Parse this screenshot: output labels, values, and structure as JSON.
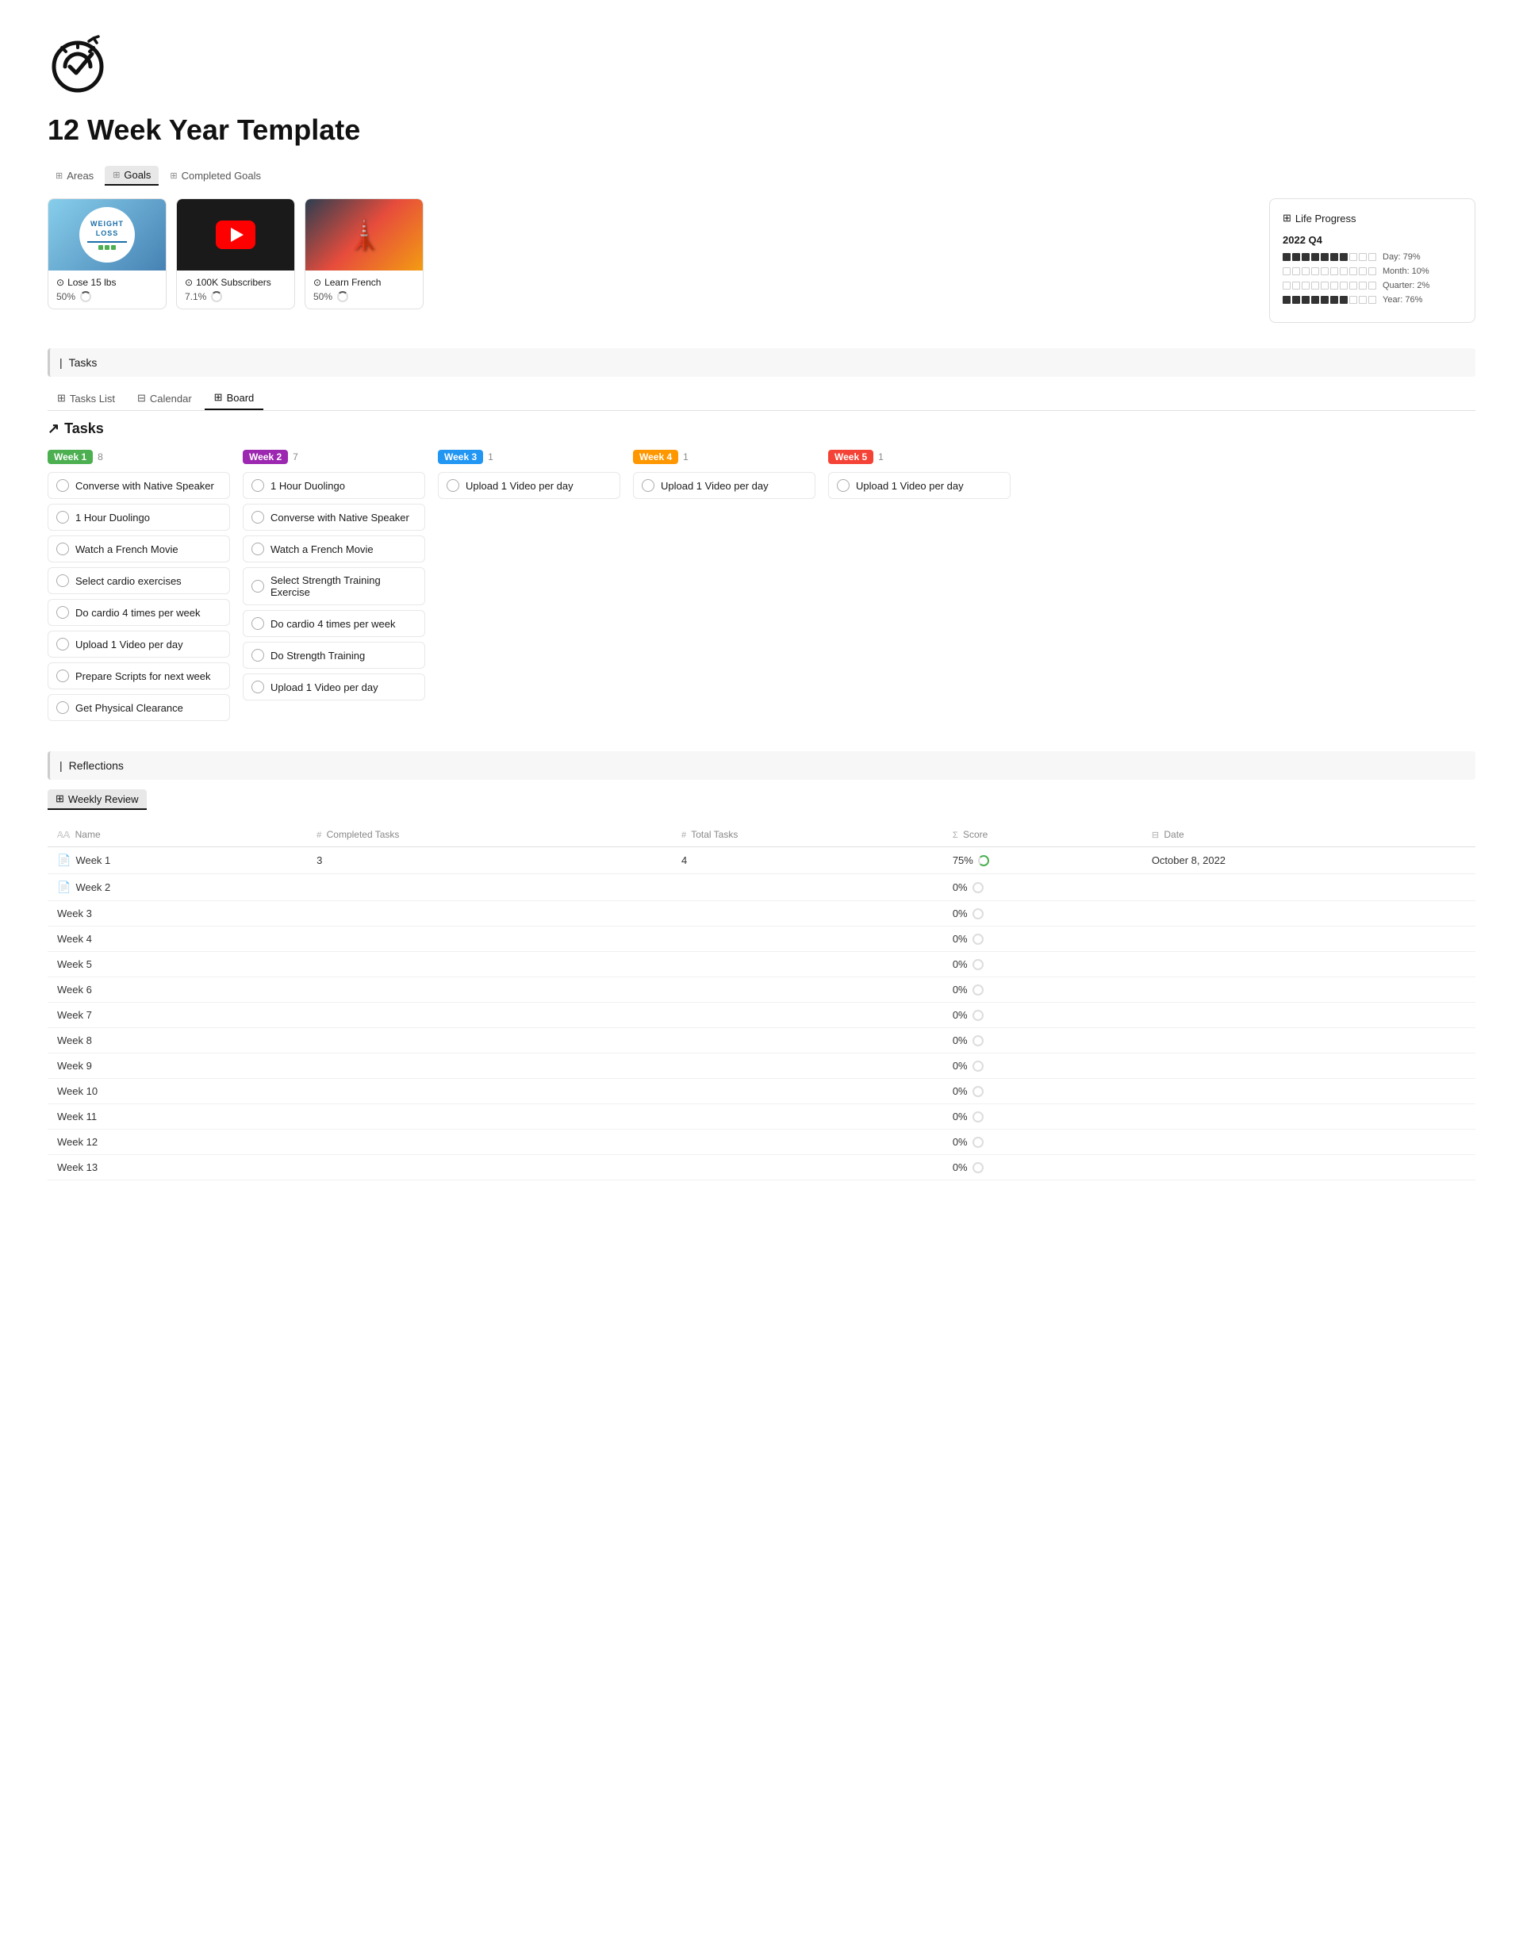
{
  "app": {
    "title": "12 Week Year Template"
  },
  "top_tabs": [
    {
      "id": "areas",
      "label": "Areas",
      "icon": "⊞",
      "active": false
    },
    {
      "id": "goals",
      "label": "Goals",
      "icon": "⊞",
      "active": true
    },
    {
      "id": "completed_goals",
      "label": "Completed Goals",
      "icon": "⊞",
      "active": false
    }
  ],
  "goals": [
    {
      "id": "lose-15-lbs",
      "title": "Lose 15 lbs",
      "progress": "50%",
      "image_type": "weight",
      "goal_icon": "⊙"
    },
    {
      "id": "100k-subscribers",
      "title": "100K Subscribers",
      "progress": "7.1%",
      "image_type": "youtube",
      "goal_icon": "⊙"
    },
    {
      "id": "learn-french",
      "title": "Learn French",
      "progress": "50%",
      "image_type": "french",
      "goal_icon": "⊙"
    }
  ],
  "life_progress": {
    "title": "Life Progress",
    "year_label": "2022 Q4",
    "rows": [
      {
        "filled": 7,
        "total": 10,
        "label": "Day: 79%"
      },
      {
        "filled": 1,
        "total": 10,
        "label": "Month: 10%"
      },
      {
        "filled": 0,
        "total": 10,
        "label": "Quarter: 2%"
      },
      {
        "filled": 7,
        "total": 10,
        "label": "Year: 76%"
      }
    ]
  },
  "tasks_section": {
    "section_label": "Tasks",
    "tabs": [
      {
        "id": "tasks-list",
        "label": "Tasks List",
        "icon": "⊞",
        "active": false
      },
      {
        "id": "calendar",
        "label": "Calendar",
        "icon": "⊟",
        "active": false
      },
      {
        "id": "board",
        "label": "Board",
        "icon": "⊞",
        "active": true
      }
    ],
    "heading": "Tasks",
    "columns": [
      {
        "id": "week1",
        "label": "Week 1",
        "badge_class": "badge-week1",
        "count": 8,
        "tasks": [
          "Converse with Native Speaker",
          "1 Hour Duolingo",
          "Watch a French Movie",
          "Select cardio exercises",
          "Do cardio 4 times per week",
          "Upload 1 Video per day",
          "Prepare Scripts for next week",
          "Get Physical Clearance"
        ]
      },
      {
        "id": "week2",
        "label": "Week 2",
        "badge_class": "badge-week2",
        "count": 7,
        "tasks": [
          "1 Hour Duolingo",
          "Converse with Native Speaker",
          "Watch a French Movie",
          "Select Strength Training Exercise",
          "Do cardio 4 times per week",
          "Do Strength Training",
          "Upload 1 Video per day"
        ]
      },
      {
        "id": "week3",
        "label": "Week 3",
        "badge_class": "badge-week3",
        "count": 1,
        "tasks": [
          "Upload 1 Video per day"
        ]
      },
      {
        "id": "week4",
        "label": "Week 4",
        "badge_class": "badge-week4",
        "count": 1,
        "tasks": [
          "Upload 1 Video per day"
        ]
      },
      {
        "id": "week5",
        "label": "Week 5",
        "badge_class": "badge-week5",
        "count": 1,
        "tasks": [
          "Upload 1 Video per day"
        ]
      }
    ]
  },
  "reflections_section": {
    "section_label": "Reflections",
    "sub_tab": "Weekly Review",
    "table": {
      "columns": [
        {
          "id": "name",
          "icon": "𝔸𝔸",
          "label": "Name"
        },
        {
          "id": "completed_tasks",
          "icon": "#",
          "label": "Completed Tasks"
        },
        {
          "id": "total_tasks",
          "icon": "#",
          "label": "Total Tasks"
        },
        {
          "id": "score",
          "icon": "Σ",
          "label": "Score"
        },
        {
          "id": "date",
          "icon": "⊟",
          "label": "Date"
        }
      ],
      "rows": [
        {
          "name": "Week 1",
          "completed_tasks": "3",
          "total_tasks": "4",
          "score": "75%",
          "score_partial": true,
          "date": "October 8, 2022",
          "has_doc": true
        },
        {
          "name": "Week 2",
          "completed_tasks": "",
          "total_tasks": "",
          "score": "0%",
          "score_partial": false,
          "date": "",
          "has_doc": true
        },
        {
          "name": "Week 3",
          "completed_tasks": "",
          "total_tasks": "",
          "score": "0%",
          "score_partial": false,
          "date": "",
          "has_doc": false
        },
        {
          "name": "Week 4",
          "completed_tasks": "",
          "total_tasks": "",
          "score": "0%",
          "score_partial": false,
          "date": "",
          "has_doc": false
        },
        {
          "name": "Week 5",
          "completed_tasks": "",
          "total_tasks": "",
          "score": "0%",
          "score_partial": false,
          "date": "",
          "has_doc": false
        },
        {
          "name": "Week 6",
          "completed_tasks": "",
          "total_tasks": "",
          "score": "0%",
          "score_partial": false,
          "date": "",
          "has_doc": false
        },
        {
          "name": "Week 7",
          "completed_tasks": "",
          "total_tasks": "",
          "score": "0%",
          "score_partial": false,
          "date": "",
          "has_doc": false
        },
        {
          "name": "Week 8",
          "completed_tasks": "",
          "total_tasks": "",
          "score": "0%",
          "score_partial": false,
          "date": "",
          "has_doc": false
        },
        {
          "name": "Week 9",
          "completed_tasks": "",
          "total_tasks": "",
          "score": "0%",
          "score_partial": false,
          "date": "",
          "has_doc": false
        },
        {
          "name": "Week 10",
          "completed_tasks": "",
          "total_tasks": "",
          "score": "0%",
          "score_partial": false,
          "date": "",
          "has_doc": false
        },
        {
          "name": "Week 11",
          "completed_tasks": "",
          "total_tasks": "",
          "score": "0%",
          "score_partial": false,
          "date": "",
          "has_doc": false
        },
        {
          "name": "Week 12",
          "completed_tasks": "",
          "total_tasks": "",
          "score": "0%",
          "score_partial": false,
          "date": "",
          "has_doc": false
        },
        {
          "name": "Week 13",
          "completed_tasks": "",
          "total_tasks": "",
          "score": "0%",
          "score_partial": false,
          "date": "",
          "has_doc": false
        }
      ]
    }
  }
}
